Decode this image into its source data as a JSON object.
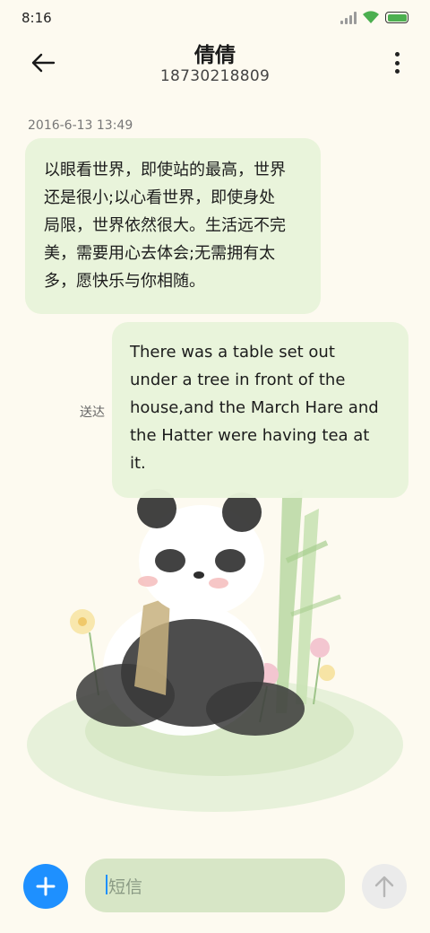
{
  "status_bar": {
    "time": "8:16",
    "icons": [
      "signal-icon",
      "wifi-icon",
      "battery-icon"
    ],
    "battery_color": "#4caf50"
  },
  "header": {
    "back_icon": "arrow-left-icon",
    "contact_name": "倩倩",
    "contact_number": "18730218809",
    "more_icon": "more-vertical-icon"
  },
  "conversation": {
    "timestamp": "2016-6-13 13:49",
    "messages": [
      {
        "direction": "incoming",
        "lines": [
          "以眼看世界，即使站的最高，世界",
          "还是很小;以心看世界，即使身处",
          "局限，世界依然很大。生活远不完",
          "美，需要用心去体会;无需拥有太",
          "多，愿快乐与你相随。"
        ]
      },
      {
        "direction": "outgoing",
        "status": "送达",
        "lines": [
          "There was a table set out",
          "under a tree in front of the",
          "house,and the March Hare and",
          "the Hatter were having tea at",
          "it."
        ]
      }
    ]
  },
  "composer": {
    "add_icon": "plus-icon",
    "placeholder": "短信",
    "send_icon": "arrow-up-icon",
    "accent_color": "#1e90ff",
    "input_bg": "#d7e6c6"
  },
  "background": {
    "illustration": "panda-bamboo-illustration"
  }
}
